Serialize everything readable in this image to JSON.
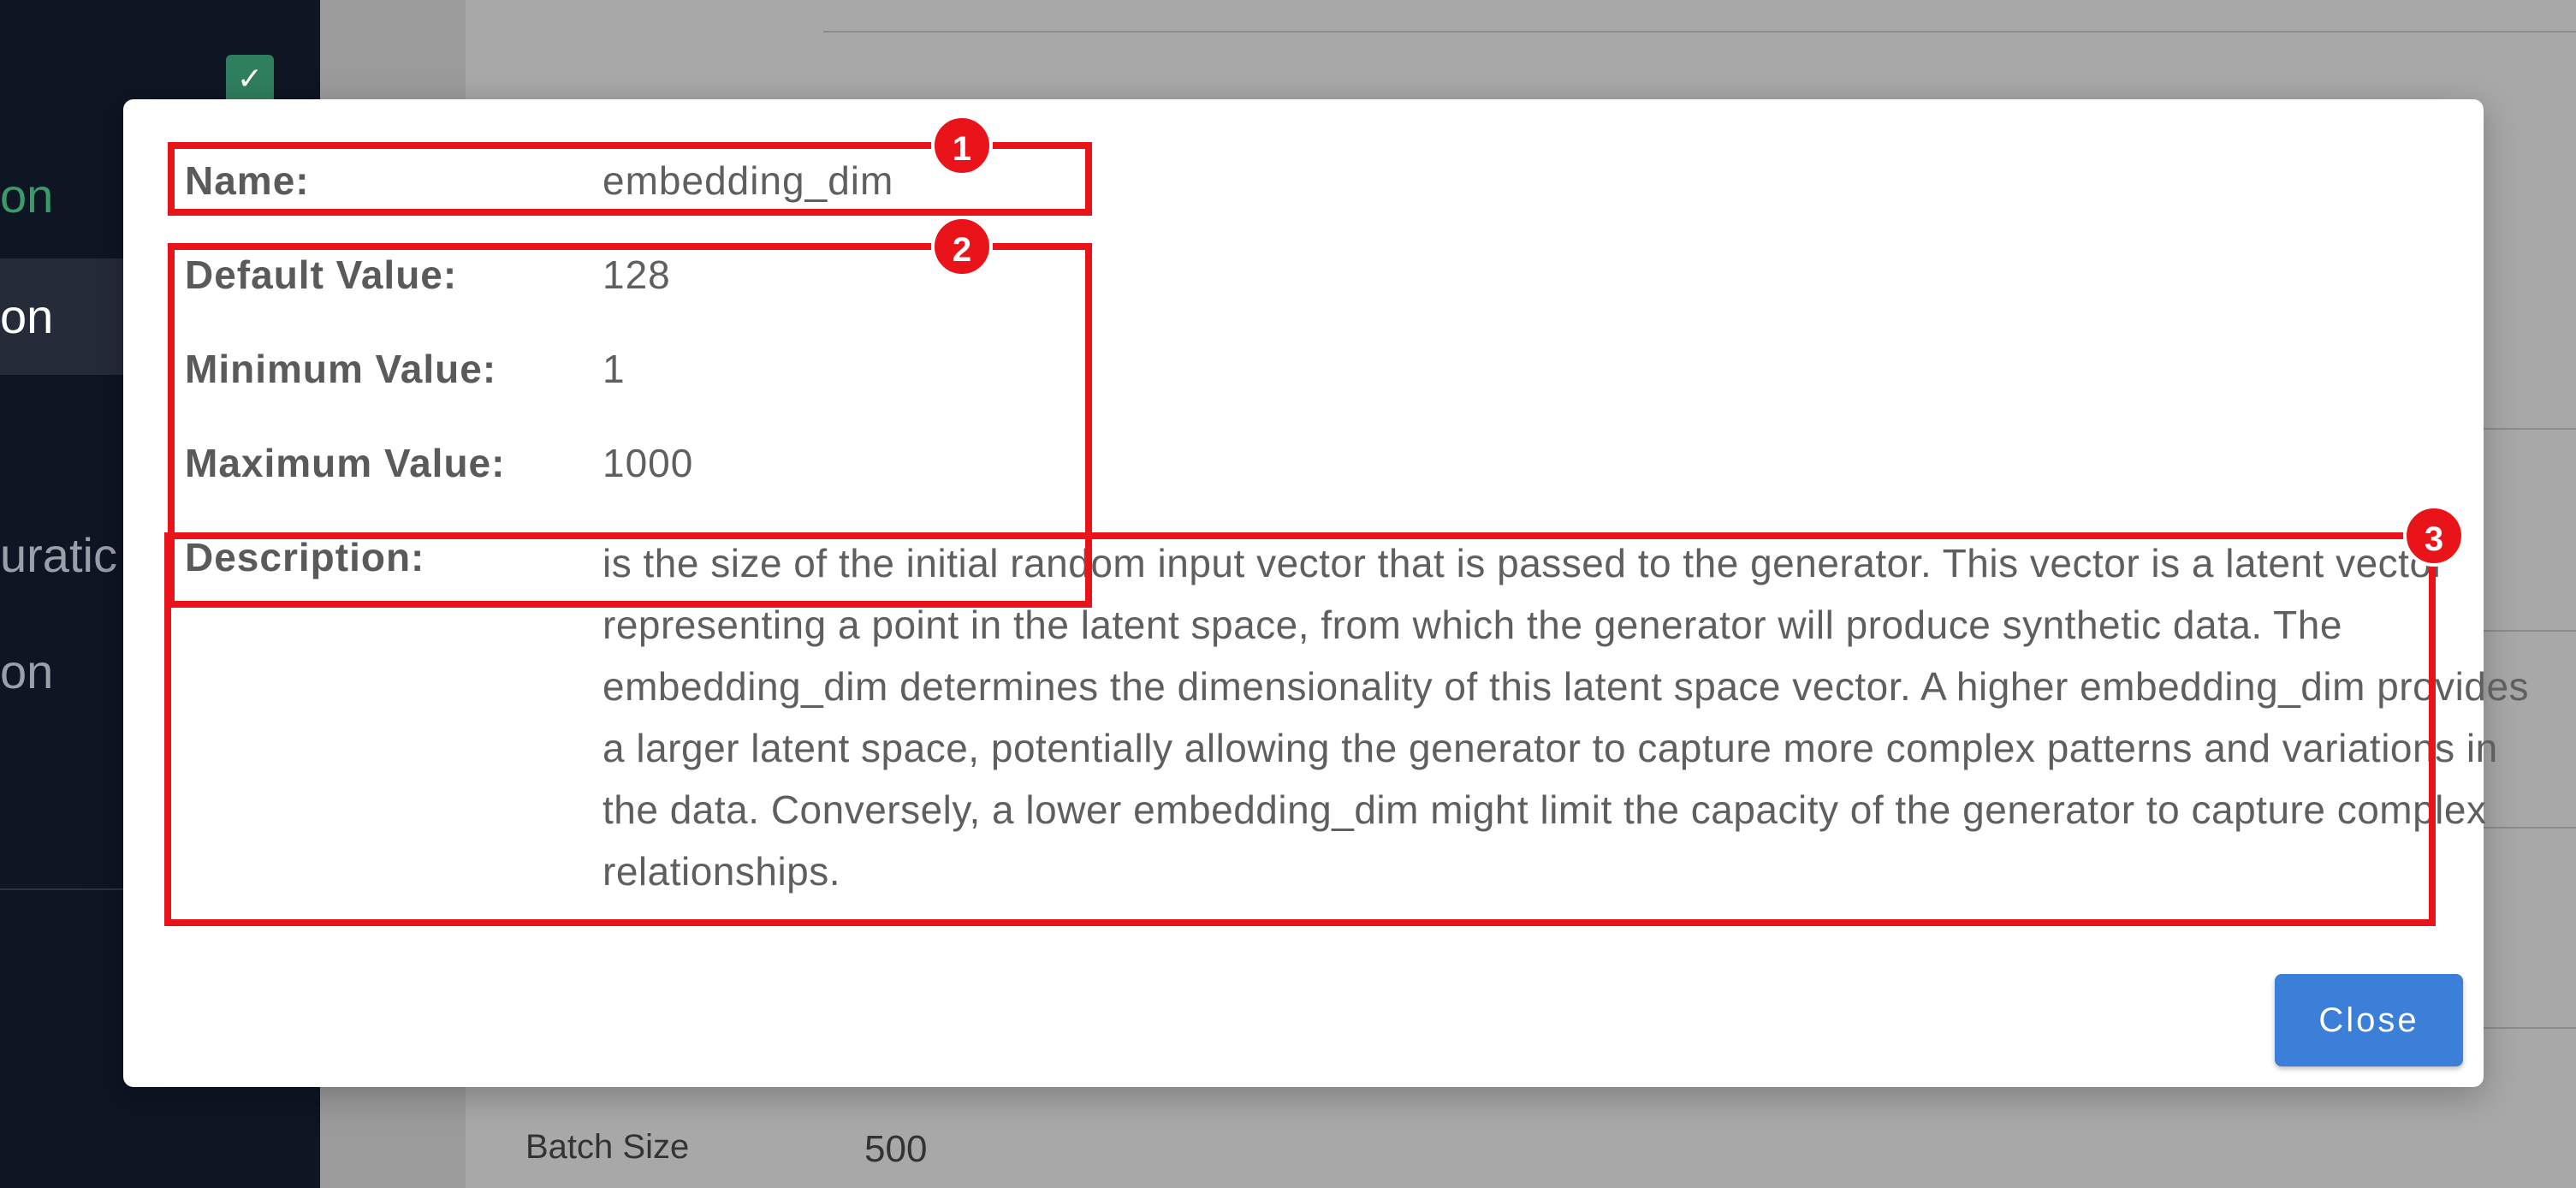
{
  "background": {
    "sidebar": {
      "items": [
        {
          "label": "on"
        },
        {
          "label": "on"
        },
        {
          "label": "uratic"
        },
        {
          "label": "on"
        }
      ]
    },
    "batch_size": {
      "label": "Batch Size",
      "value": "500"
    }
  },
  "modal": {
    "fields": {
      "name": {
        "label": "Name:",
        "value": "embedding_dim"
      },
      "default": {
        "label": "Default Value:",
        "value": "128"
      },
      "minimum": {
        "label": "Minimum Value:",
        "value": "1"
      },
      "maximum": {
        "label": "Maximum Value:",
        "value": "1000"
      },
      "description": {
        "label": "Description:",
        "value": "is the size of the initial random input vector that is passed to the generator. This vector is a latent vector representing a point in the latent space, from which the generator will produce synthetic data. The embedding_dim determines the dimensionality of this latent space vector. A higher embedding_dim provides a larger latent space, potentially allowing the generator to capture more complex patterns and variations in the data. Conversely, a lower embedding_dim might limit the capacity of the generator to capture complex relationships."
      }
    },
    "annotations": [
      "1",
      "2",
      "3"
    ],
    "close_label": "Close"
  },
  "colors": {
    "accent": "#3b7fd9",
    "annotation": "#e8141a",
    "sidebar_bg": "#0e1523",
    "sidebar_active_green": "#3a9a6a"
  }
}
